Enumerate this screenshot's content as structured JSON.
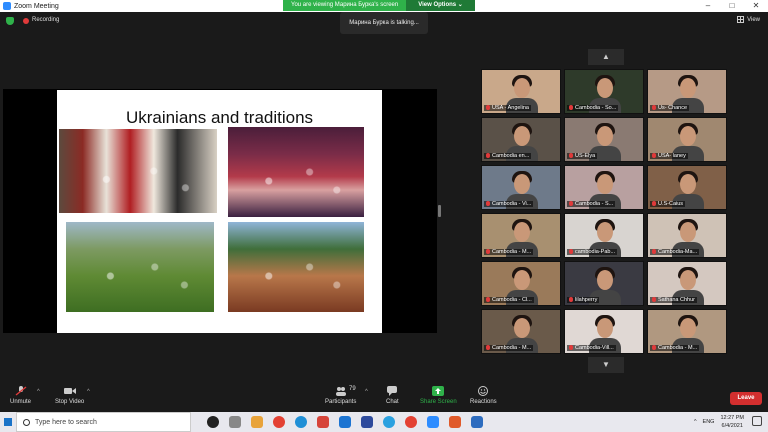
{
  "window": {
    "title": "Zoom Meeting"
  },
  "share_banner": {
    "viewing": "You are viewing Марина Бурка's screen",
    "options": "View Options ⌄"
  },
  "topbar": {
    "recording": "Recording",
    "talking": "Марина Бурка is talking...",
    "view": "View"
  },
  "slide": {
    "title": "Ukrainians and traditions"
  },
  "participants_tiles": [
    {
      "name": "USA - Angelina",
      "color": "#c9a88a"
    },
    {
      "name": "Cambodia - So...",
      "color": "#2e3a2a"
    },
    {
      "name": "Us- Chance",
      "color": "#b69a86"
    },
    {
      "name": "Cambodia en...",
      "color": "#5a5148"
    },
    {
      "name": "US-Elya",
      "color": "#8a7a72"
    },
    {
      "name": "USA- laney",
      "color": "#a08870"
    },
    {
      "name": "Cambodia - Vi...",
      "color": "#6e7a8a"
    },
    {
      "name": "Cambodia - S...",
      "color": "#b8a0a0"
    },
    {
      "name": "U.S-Caius",
      "color": "#806048"
    },
    {
      "name": "Cambodia - M...",
      "color": "#a89070"
    },
    {
      "name": "cambodia-Pab...",
      "color": "#d8d4d0"
    },
    {
      "name": "Cambodia-Ma...",
      "color": "#cfc2b6"
    },
    {
      "name": "Cambodia - Cl...",
      "color": "#9a7a5a"
    },
    {
      "name": "lilahperry",
      "color": "#3a3a42"
    },
    {
      "name": "Sathana Chhur",
      "color": "#d4c8c0"
    },
    {
      "name": "Cambodia - M...",
      "color": "#6a5a4a"
    },
    {
      "name": "Cambodia-Vill...",
      "color": "#e0d8d4"
    },
    {
      "name": "Cambodia - M...",
      "color": "#b09880"
    }
  ],
  "toolbar": {
    "unmute": "Unmute",
    "stop_video": "Stop Video",
    "participants": "Participants",
    "participants_count": "79",
    "chat": "Chat",
    "share_screen": "Share Screen",
    "reactions": "Reactions",
    "leave": "Leave"
  },
  "taskbar": {
    "search_placeholder": "Type here to search",
    "lang": "ENG",
    "time": "12:27 PM",
    "date": "6/4/2021"
  },
  "colors": {
    "green": "#2fb24a",
    "red": "#d32f2f",
    "blue": "#2d8cff"
  }
}
